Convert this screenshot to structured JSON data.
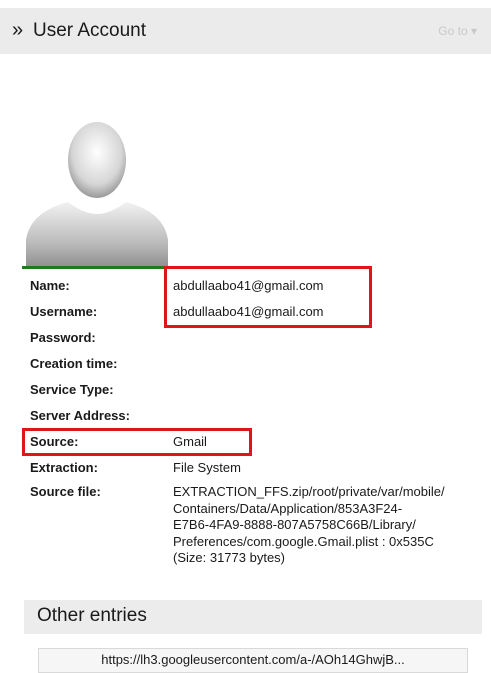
{
  "header": {
    "chevron": "»",
    "title": "User Account",
    "goto_label": "Go to ▾"
  },
  "fields": {
    "name": {
      "label": "Name:",
      "value": "abdullaabo41@gmail.com"
    },
    "username": {
      "label": "Username:",
      "value": "abdullaabo41@gmail.com"
    },
    "password": {
      "label": "Password:",
      "value": ""
    },
    "creation_time": {
      "label": "Creation time:",
      "value": ""
    },
    "service_type": {
      "label": "Service Type:",
      "value": ""
    },
    "server_address": {
      "label": "Server Address:",
      "value": ""
    },
    "source": {
      "label": "Source:",
      "value": "Gmail"
    },
    "extraction": {
      "label": "Extraction:",
      "value": "File System"
    },
    "source_file": {
      "label": "Source file:",
      "lines": [
        "EXTRACTION_FFS.zip/root/private/var/mobile/",
        "Containers/Data/Application/853A3F24-",
        "E7B6-4FA9-8888-807A5758C66B/Library/",
        "Preferences/com.google.Gmail.plist : 0x535C",
        "(Size: 31773 bytes)"
      ]
    }
  },
  "other_entries": {
    "title": "Other entries",
    "url": "https://lh3.googleusercontent.com/a-/AOh14GhwjB..."
  },
  "colors": {
    "highlight": "#e0151b",
    "avatar_underline": "#1f7a1f"
  }
}
